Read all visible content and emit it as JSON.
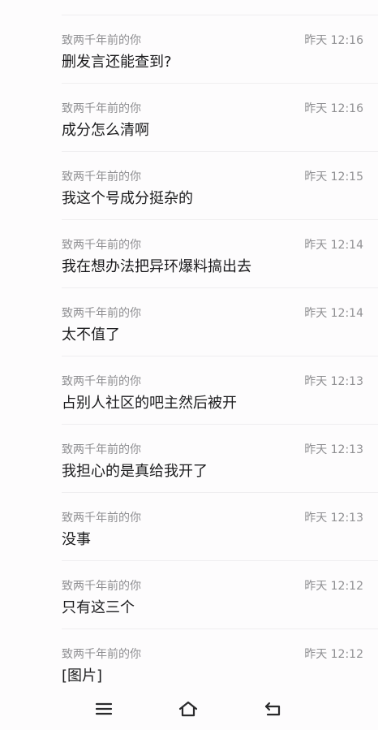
{
  "messages": [
    {
      "sender": "致两千年前的你",
      "time": "昨天 12:16",
      "text": "删发言还能查到?"
    },
    {
      "sender": "致两千年前的你",
      "time": "昨天 12:16",
      "text": "成分怎么清啊"
    },
    {
      "sender": "致两千年前的你",
      "time": "昨天 12:15",
      "text": "我这个号成分挺杂的"
    },
    {
      "sender": "致两千年前的你",
      "time": "昨天 12:14",
      "text": "我在想办法把异环爆料搞出去"
    },
    {
      "sender": "致两千年前的你",
      "time": "昨天 12:14",
      "text": "太不值了"
    },
    {
      "sender": "致两千年前的你",
      "time": "昨天 12:13",
      "text": "占别人社区的吧主然后被开"
    },
    {
      "sender": "致两千年前的你",
      "time": "昨天 12:13",
      "text": "我担心的是真给我开了"
    },
    {
      "sender": "致两千年前的你",
      "time": "昨天 12:13",
      "text": "没事"
    },
    {
      "sender": "致两千年前的你",
      "time": "昨天 12:12",
      "text": "只有这三个"
    },
    {
      "sender": "致两千年前的你",
      "time": "昨天 12:12",
      "text": "[图片]"
    }
  ],
  "navbar": {
    "menu_icon": "menu-icon",
    "home_icon": "home-icon",
    "back_icon": "back-icon"
  },
  "colors": {
    "background": "#fdfcfd",
    "meta_text": "#8f8f92",
    "body_text": "#1b1b1d",
    "divider": "#efeef0"
  }
}
